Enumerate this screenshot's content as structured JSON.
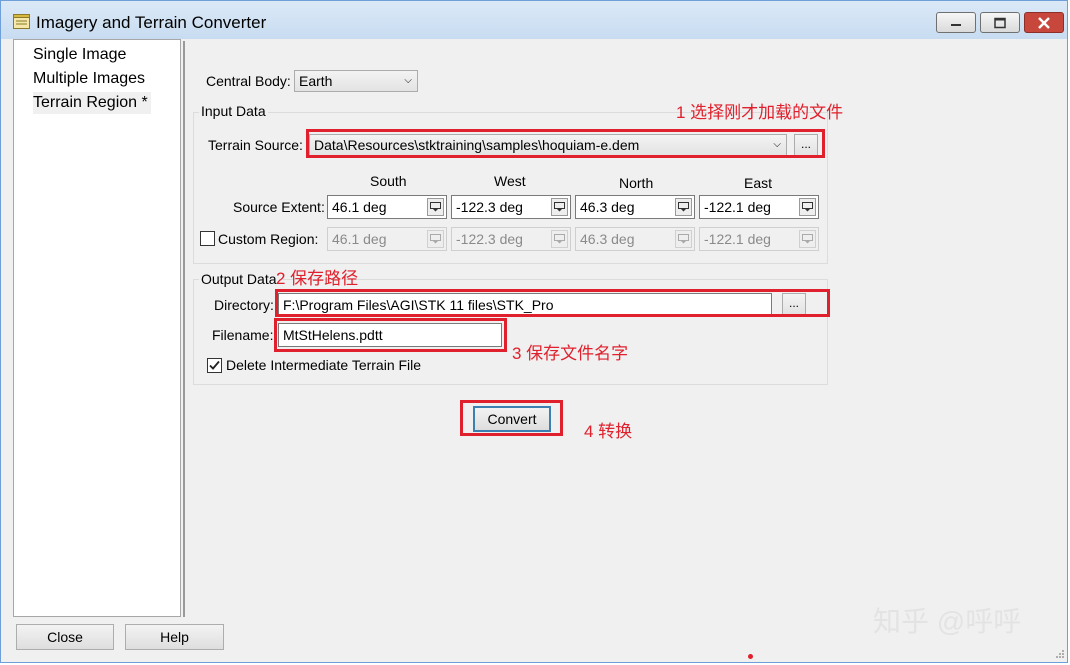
{
  "window": {
    "title": "Imagery and Terrain Converter"
  },
  "sidebar": {
    "items": [
      {
        "label": "Single Image"
      },
      {
        "label": "Multiple Images"
      },
      {
        "label": "Terrain Region *"
      }
    ]
  },
  "central_body": {
    "label": "Central Body:",
    "value": "Earth"
  },
  "input_data": {
    "title": "Input Data",
    "terrain_source_label": "Terrain Source:",
    "terrain_source_value": "Data\\Resources\\stktraining\\samples\\hoquiam-e.dem",
    "browse_label": "...",
    "columns": [
      "South",
      "West",
      "North",
      "East"
    ],
    "source_extent_label": "Source Extent:",
    "source_extent": [
      "46.1 deg",
      "-122.3 deg",
      "46.3 deg",
      "-122.1 deg"
    ],
    "custom_region_label": "Custom Region:",
    "custom_region": [
      "46.1 deg",
      "-122.3 deg",
      "46.3 deg",
      "-122.1 deg"
    ]
  },
  "output_data": {
    "title": "Output Data",
    "directory_label": "Directory:",
    "directory_value": "F:\\Program Files\\AGI\\STK 11 files\\STK_Pro",
    "browse_label": "...",
    "filename_label": "Filename:",
    "filename_value": "MtStHelens.pdtt",
    "delete_intermediate_label": "Delete Intermediate Terrain File"
  },
  "convert_label": "Convert",
  "footer": {
    "close_label": "Close",
    "help_label": "Help"
  },
  "annotations": {
    "a1": "1 选择刚才加载的文件",
    "a2": "2 保存路径",
    "a3": "3 保存文件名字",
    "a4": "4 转换"
  },
  "watermark": "知乎 @呼呼",
  "colors": {
    "annotation_red": "#e0202c",
    "title_bar": "#c8dcf1",
    "default_button_border": "#3c7fb1"
  }
}
